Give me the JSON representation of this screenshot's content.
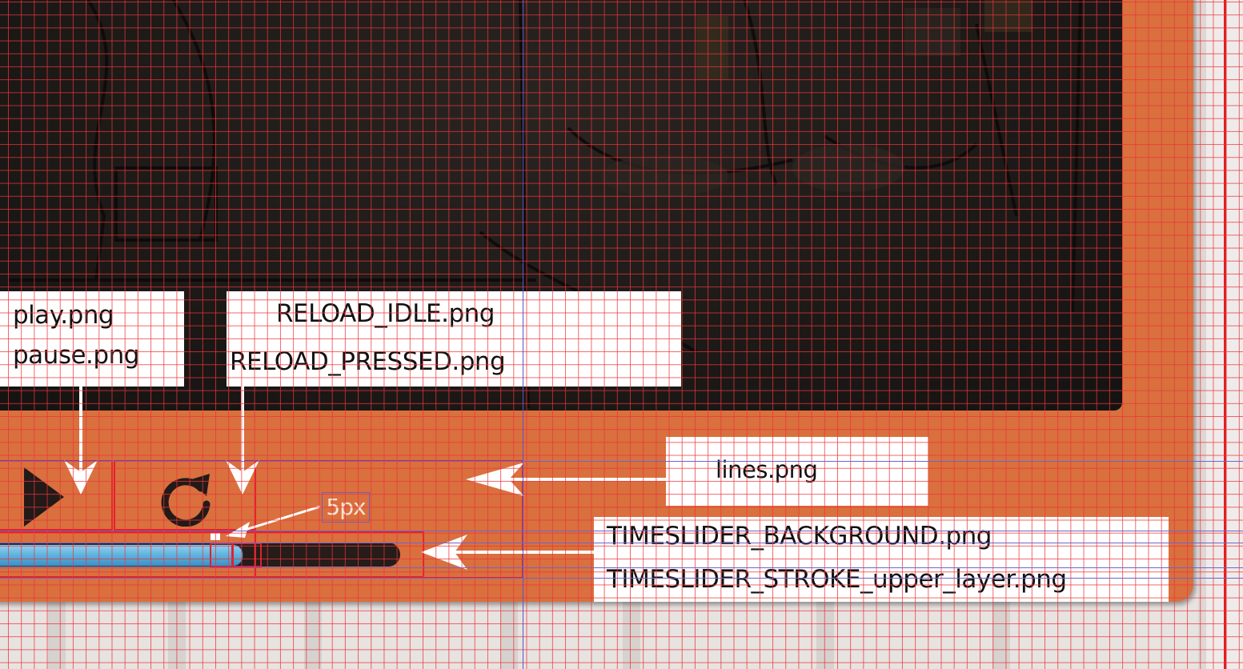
{
  "labels": {
    "play": "play.png",
    "pause": "pause.png",
    "reload_idle": "RELOAD_IDLE.png",
    "reload_pressed": "RELOAD_PRESSED.png",
    "lines": "lines.png",
    "timeslider_background": "TIMESLIDER_BACKGROUND.png",
    "timeslider_stroke": "TIMESLIDER_STROKE_upper_layer.png",
    "spacing_annotation": "5px"
  },
  "icons": {
    "play": "play-icon",
    "reload": "reload-icon",
    "arrows": "arrow-icon"
  },
  "colors": {
    "frame": "#d9703e",
    "screen": "#1d1a18",
    "slider_fill": "#5aaedb",
    "slider_track": "#261c19",
    "outline": "#e3202a",
    "grid": "#ec3438",
    "guide": "#5b55c6"
  },
  "timeslider": {
    "progress_percent": 62
  }
}
